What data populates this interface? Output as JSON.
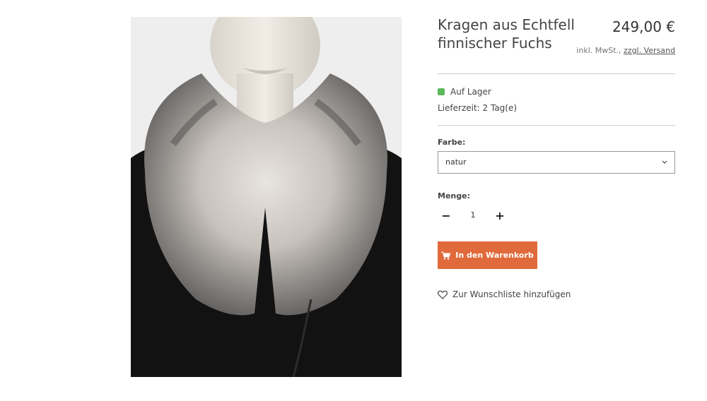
{
  "product": {
    "title": "Kragen aus Echtfell finnischer Fuchs",
    "price": "249,00 €",
    "tax_note": "inkl. MwSt.,",
    "shipping_link": "zzgl. Versand",
    "stock_status": "Auf Lager",
    "delivery_time": "Lieferzeit: 2 Tag(e)",
    "stock_color": "#5cb85c"
  },
  "options": {
    "color_label": "Farbe:",
    "color_value": "natur"
  },
  "quantity": {
    "label": "Menge:",
    "minus": "−",
    "value": "1",
    "plus": "+"
  },
  "actions": {
    "add_to_cart": "In den Warenkorb",
    "cart_icon": "cart-icon",
    "wishlist": "Zur Wunschliste hinzufügen",
    "wishlist_icon": "heart-icon",
    "accent_color": "#e06a3b"
  }
}
